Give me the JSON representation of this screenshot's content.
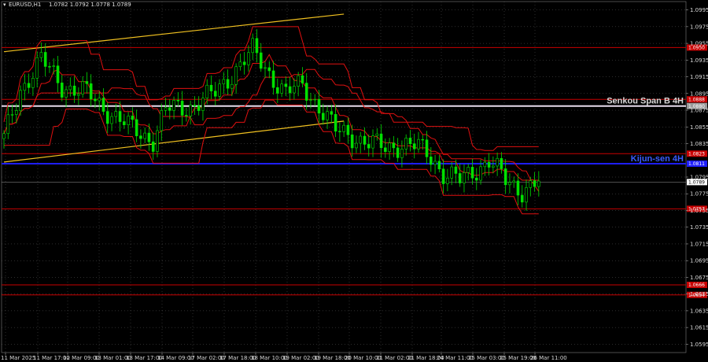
{
  "header": {
    "symbol": "EURUSD,H1",
    "ohlc": "1.0782 1.0792 1.0778 1.0789"
  },
  "colors": {
    "background": "#000000",
    "grid": "#5a5a5a",
    "candle": "#00e000",
    "ichimoku": "#e01010",
    "channel": "#f0c020",
    "level_red": "#c80000",
    "kijun": "#1e1eff",
    "senkou": "#e8dcec"
  },
  "chart_data": {
    "type": "line",
    "title": "",
    "xlabel": "",
    "ylabel": "",
    "ylim": [
      1.0585,
      1.1005
    ],
    "y_ticks": [
      "1.0995",
      "1.0975",
      "1.0955",
      "1.0935",
      "1.0915",
      "1.0895",
      "1.0875",
      "1.0855",
      "1.0835",
      "1.0795",
      "1.0775",
      "1.0755",
      "1.0735",
      "1.0715",
      "1.0695",
      "1.0675",
      "1.0655",
      "1.0635",
      "1.0615",
      "1.0595"
    ],
    "x_ticks": [
      "11 Mar 2025",
      "11 Mar 17:00",
      "12 Mar 09:00",
      "13 Mar 01:00",
      "13 Mar 17:00",
      "14 Mar 09:00",
      "17 Mar 02:00",
      "17 Mar 18:00",
      "18 Mar 10:00",
      "19 Mar 02:00",
      "19 Mar 18:00",
      "20 Mar 10:00",
      "21 Mar 02:00",
      "21 Mar 18:00",
      "24 Mar 11:00",
      "25 Mar 03:00",
      "25 Mar 19:00",
      "26 Mar 11:00"
    ],
    "bar_count": 130,
    "close_anchors": [
      [
        0,
        1.084
      ],
      [
        4,
        1.09
      ],
      [
        9,
        1.0935
      ],
      [
        14,
        1.0905
      ],
      [
        20,
        1.0895
      ],
      [
        25,
        1.0875
      ],
      [
        30,
        1.0855
      ],
      [
        36,
        1.084
      ],
      [
        39,
        1.0875
      ],
      [
        45,
        1.088
      ],
      [
        51,
        1.0895
      ],
      [
        56,
        1.0925
      ],
      [
        60,
        1.0945
      ],
      [
        64,
        1.092
      ],
      [
        68,
        1.0895
      ],
      [
        72,
        1.0905
      ],
      [
        76,
        1.088
      ],
      [
        80,
        1.085
      ],
      [
        84,
        1.0845
      ],
      [
        88,
        1.0835
      ],
      [
        92,
        1.083
      ],
      [
        96,
        1.0835
      ],
      [
        100,
        1.083
      ],
      [
        103,
        1.082
      ],
      [
        106,
        1.08
      ],
      [
        110,
        1.079
      ],
      [
        114,
        1.0805
      ],
      [
        117,
        1.0815
      ],
      [
        121,
        1.079
      ],
      [
        125,
        1.078
      ],
      [
        129,
        1.0789
      ]
    ],
    "current_price": "1.0789",
    "horizontal_levels": [
      {
        "price": 1.095,
        "label": "1.0950",
        "kind": "red"
      },
      {
        "price": 1.0888,
        "label": "1.0888",
        "kind": "red"
      },
      {
        "price": 1.088,
        "label": "1.0880",
        "kind": "senkou",
        "name": "Senkou Span B 4H"
      },
      {
        "price": 1.0823,
        "label": "1.0823",
        "kind": "red"
      },
      {
        "price": 1.0811,
        "label": "1.0811",
        "kind": "kijun",
        "name": "Kijun-sen 4H"
      },
      {
        "price": 1.0757,
        "label": "1.0757",
        "kind": "red"
      },
      {
        "price": 1.0666,
        "label": "1.0666",
        "kind": "red"
      },
      {
        "price": 1.0654,
        "label": "1.0654",
        "kind": "red"
      }
    ],
    "trend_lines": [
      {
        "from": [
          0,
          1.0945
        ],
        "to": [
          82,
          1.099
        ]
      },
      {
        "from": [
          0,
          1.0813
        ],
        "to": [
          82,
          1.0862
        ]
      }
    ]
  }
}
